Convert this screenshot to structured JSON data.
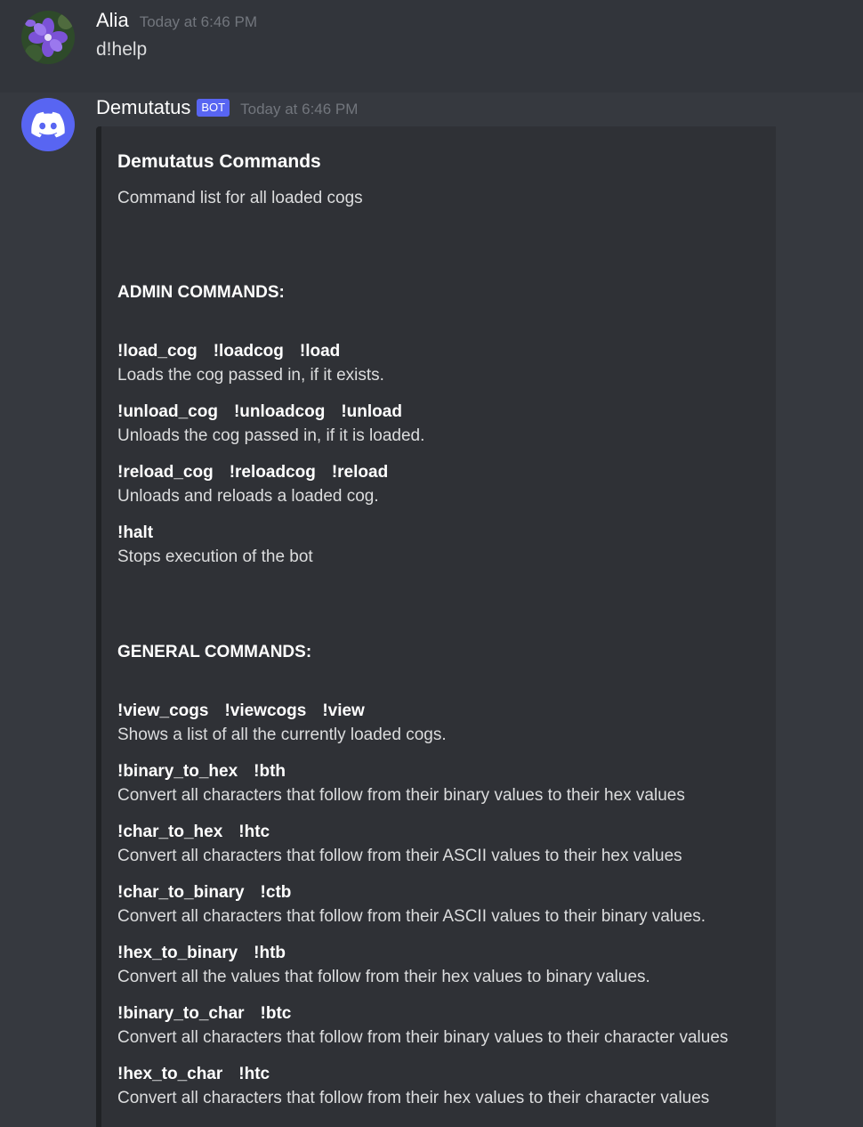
{
  "messages": {
    "user": {
      "name": "Alia",
      "time": "Today at 6:46 PM",
      "text": "d!help",
      "avatar_icon": "purple-flower-avatar"
    },
    "bot": {
      "name": "Demutatus",
      "tag": "BOT",
      "time": "Today at 6:46 PM",
      "avatar_icon": "discord-logo-icon"
    }
  },
  "embed": {
    "title": "Demutatus Commands",
    "description": "Command list for all loaded cogs",
    "admin_heading": "ADMIN COMMANDS:",
    "admin_commands": [
      {
        "names": [
          "!load_cog",
          "!loadcog",
          "!load"
        ],
        "desc": "Loads the cog passed in, if it exists."
      },
      {
        "names": [
          "!unload_cog",
          "!unloadcog",
          "!unload"
        ],
        "desc": "Unloads the cog passed in, if it is loaded."
      },
      {
        "names": [
          "!reload_cog",
          "!reloadcog",
          "!reload"
        ],
        "desc": "Unloads and reloads a loaded cog."
      },
      {
        "names": [
          "!halt"
        ],
        "desc": "Stops execution of the bot"
      }
    ],
    "general_heading": "GENERAL COMMANDS:",
    "general_commands": [
      {
        "names": [
          "!view_cogs",
          "!viewcogs",
          "!view"
        ],
        "desc": "Shows a list of all the currently loaded cogs."
      },
      {
        "names": [
          "!binary_to_hex",
          "!bth"
        ],
        "desc": "Convert all characters that follow from their binary values to their hex values"
      },
      {
        "names": [
          "!char_to_hex",
          "!htc"
        ],
        "desc": "Convert all characters that follow from their ASCII values to their hex values"
      },
      {
        "names": [
          "!char_to_binary",
          "!ctb"
        ],
        "desc": "Convert all characters that follow from their ASCII values to their binary values."
      },
      {
        "names": [
          "!hex_to_binary",
          "!htb"
        ],
        "desc": "Convert all the values that follow from their hex values to binary values."
      },
      {
        "names": [
          "!binary_to_char",
          "!btc"
        ],
        "desc": "Convert all characters that follow from their binary values to their character values"
      },
      {
        "names": [
          "!hex_to_char",
          "!htc"
        ],
        "desc": "Convert all characters that follow from their hex values to their character values"
      }
    ]
  },
  "colors": {
    "background": "#36393f",
    "embed_background": "#2f3136",
    "bot_tag": "#5865f2",
    "timestamp": "#72767d"
  }
}
